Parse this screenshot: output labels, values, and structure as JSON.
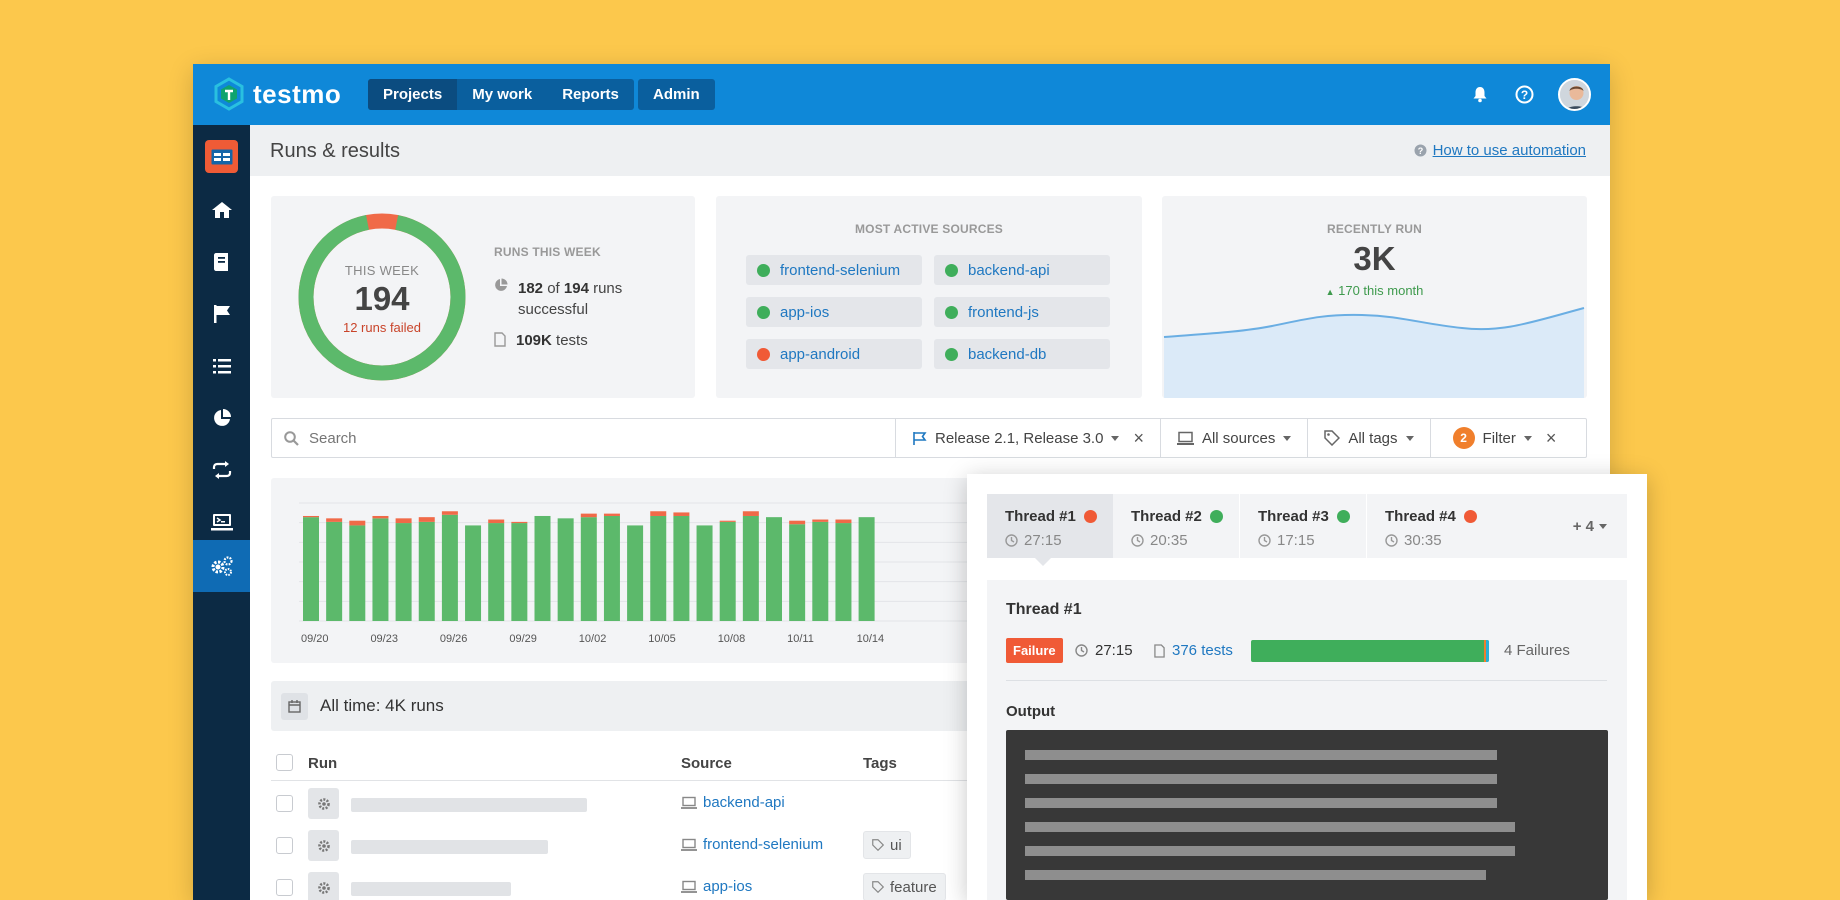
{
  "app": {
    "brand": "testmo",
    "nav": [
      "Projects",
      "My work",
      "Reports"
    ],
    "admin": "Admin"
  },
  "icons": {
    "notifications": "bell-icon",
    "help": "help-circle-icon",
    "sidebar": [
      "home-icon",
      "book-icon",
      "flag-icon",
      "list-icon",
      "pie-chart-icon",
      "repeat-icon",
      "automation-icon",
      "settings-icon"
    ]
  },
  "page": {
    "title": "Runs & results",
    "help_link": "How to use automation"
  },
  "week_card": {
    "ring_label": "THIS WEEK",
    "ring_value": "194",
    "ring_failed": "12 runs failed",
    "success_fraction": 0.938,
    "heading": "RUNS THIS WEEK",
    "success_count": "182",
    "of_word": "of",
    "total_count": "194",
    "runs_word": "runs",
    "successful_word": "successful",
    "tests_count": "109K",
    "tests_word": "tests"
  },
  "sources_card": {
    "heading": "MOST ACTIVE SOURCES",
    "items": [
      {
        "name": "frontend-selenium",
        "status": "green"
      },
      {
        "name": "backend-api",
        "status": "green"
      },
      {
        "name": "app-ios",
        "status": "green"
      },
      {
        "name": "frontend-js",
        "status": "green"
      },
      {
        "name": "app-android",
        "status": "red"
      },
      {
        "name": "backend-db",
        "status": "green"
      }
    ]
  },
  "recent_card": {
    "heading": "RECENTLY RUN",
    "value": "3K",
    "delta": "170 this month"
  },
  "filters": {
    "search_placeholder": "Search",
    "milestone": "Release 2.1, Release 3.0",
    "sources": "All sources",
    "tags": "All tags",
    "filter_count": "2",
    "filter_label": "Filter"
  },
  "chart_data": {
    "type": "bar",
    "stacked": true,
    "x_tick_labels": [
      "09/20",
      "09/23",
      "09/26",
      "09/29",
      "10/02",
      "10/05",
      "10/08",
      "10/11",
      "10/14"
    ],
    "series": [
      {
        "name": "passed",
        "color": "#5cb96b",
        "values": [
          88,
          84,
          81,
          87,
          83,
          84,
          90,
          81,
          83,
          83,
          89,
          87,
          88,
          89,
          81,
          89,
          89,
          81,
          84,
          89,
          88,
          82,
          84,
          83,
          88
        ]
      },
      {
        "name": "failed",
        "color": "#f06a48",
        "values": [
          1,
          3,
          4,
          2,
          4,
          4,
          3,
          0,
          3,
          1,
          0,
          0,
          3,
          2,
          0,
          4,
          3,
          0,
          1,
          4,
          0,
          3,
          2,
          3,
          0
        ]
      }
    ],
    "grid": true
  },
  "runs": {
    "all_time": "All time: 4K runs",
    "columns": [
      "Run",
      "Source",
      "Tags"
    ],
    "rows": [
      {
        "source": "backend-api",
        "tags": []
      },
      {
        "source": "frontend-selenium",
        "tags": [
          "ui"
        ]
      },
      {
        "source": "app-ios",
        "tags": [
          "feature"
        ]
      }
    ]
  },
  "threads": {
    "tabs": [
      {
        "name": "Thread #1",
        "time": "27:15",
        "status": "red"
      },
      {
        "name": "Thread #2",
        "time": "20:35",
        "status": "green"
      },
      {
        "name": "Thread #3",
        "time": "17:15",
        "status": "green"
      },
      {
        "name": "Thread #4",
        "time": "30:35",
        "status": "red"
      }
    ],
    "more": "+ 4",
    "detail": {
      "title": "Thread #1",
      "status": "Failure",
      "time": "27:15",
      "tests": "376 tests",
      "failures": "4 Failures",
      "failed_fraction": 0.02,
      "output_label": "Output"
    }
  },
  "colors": {
    "accent": "#0f88d8",
    "sidebar": "#0c2a44",
    "success": "#3fae5b",
    "failure": "#f05a36",
    "background": "#fcc84c"
  }
}
